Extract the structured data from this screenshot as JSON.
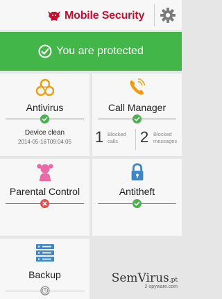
{
  "header": {
    "app_name": "Mobile Security",
    "logo_icon": "bull-logo-icon",
    "settings_icon": "gear-icon"
  },
  "banner": {
    "status_text": "You are protected",
    "icon": "check-circle-icon",
    "color": "#43b649"
  },
  "tiles": {
    "antivirus": {
      "title": "Antivirus",
      "status": "ok",
      "status_main": "Device clean",
      "status_sub": "2014-05-16T09:04:05"
    },
    "call_manager": {
      "title": "Call Manager",
      "status": "ok",
      "blocked_calls_count": "1",
      "blocked_calls_label_1": "Blocked",
      "blocked_calls_label_2": "calls",
      "blocked_messages_count": "2",
      "blocked_messages_label_1": "Blocked",
      "blocked_messages_label_2": "messages"
    },
    "parental_control": {
      "title": "Parental Control",
      "status": "error"
    },
    "antitheft": {
      "title": "Antitheft",
      "status": "ok"
    },
    "backup": {
      "title": "Backup",
      "status": "pending"
    }
  },
  "watermark": {
    "main": "SemVirus",
    "suffix": ".pt",
    "sub": "2-spyware.com"
  },
  "colors": {
    "ok": "#4cb050",
    "error": "#d9534f",
    "brand": "#c8102e",
    "accent_orange": "#f39c12",
    "accent_pink": "#e96aa5",
    "accent_blue": "#3f86c7"
  }
}
